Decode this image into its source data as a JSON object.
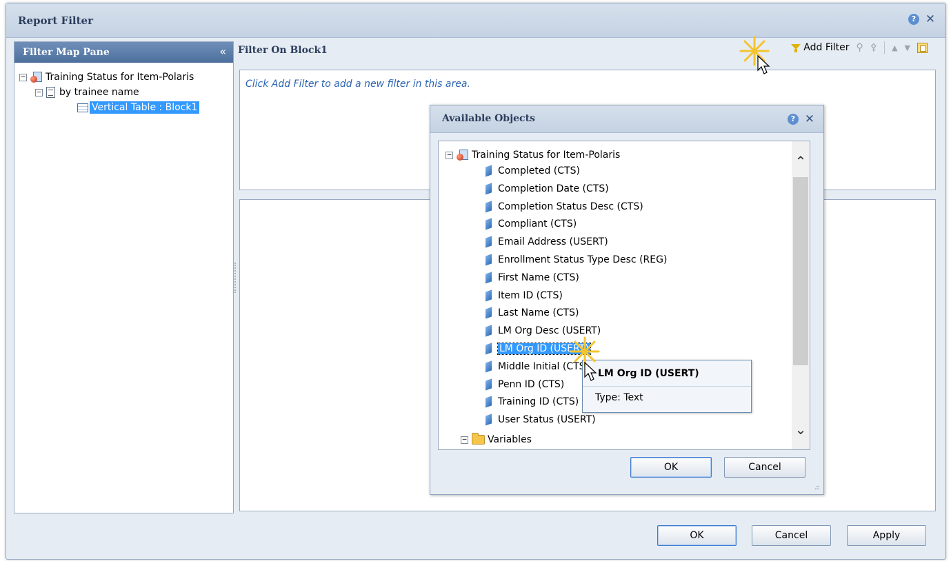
{
  "dialog": {
    "title": "Report Filter",
    "ok_label": "OK",
    "cancel_label": "Cancel",
    "apply_label": "Apply"
  },
  "filter_map": {
    "title": "Filter Map Pane",
    "collapse_glyph": "«",
    "tree": {
      "root": "Training Status for Item-Polaris",
      "child": "by trainee name",
      "leaf": "Vertical Table : Block1"
    }
  },
  "filter_on": {
    "title": "Filter On Block1",
    "add_filter_label": "Add Filter",
    "hint": "Click Add Filter to add a new filter in this area."
  },
  "available_objects": {
    "title": "Available Objects",
    "root": "Training Status for Item-Polaris",
    "items": [
      "Completed (CTS)",
      "Completion Date (CTS)",
      "Completion Status Desc (CTS)",
      "Compliant (CTS)",
      "Email Address (USERT)",
      "Enrollment Status Type Desc (REG)",
      "First Name (CTS)",
      "Item ID (CTS)",
      "Last Name (CTS)",
      "LM Org Desc (USERT)",
      "LM Org ID (USERT)",
      "Middle Initial (CTS)",
      "Penn ID (CTS)",
      "Training ID (CTS)",
      "User Status (USERT)"
    ],
    "selected_index": 10,
    "variables_label": "Variables",
    "ok_label": "OK",
    "cancel_label": "Cancel"
  },
  "tooltip": {
    "title": "LM Org ID (USERT)",
    "type_text": "Type: Text"
  },
  "icons": {
    "help": "?",
    "close": "✕"
  },
  "colors": {
    "selection": "#3399ff",
    "pane_header": "#4c6f9d",
    "hint_text": "#2b63b3"
  }
}
